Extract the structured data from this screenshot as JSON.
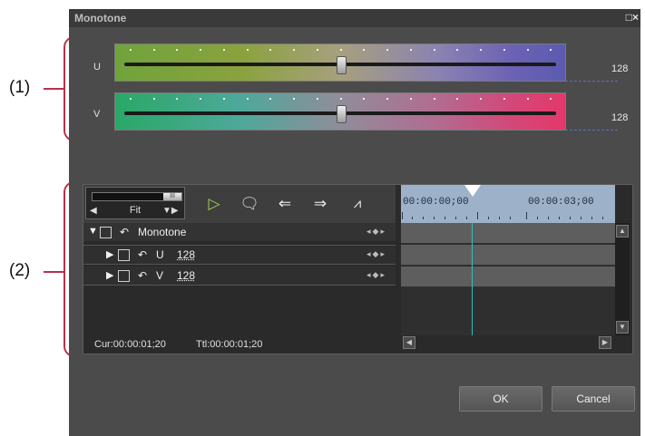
{
  "annotations": {
    "one": "(1)",
    "two": "(2)"
  },
  "dialog": {
    "title": "Monotone",
    "window_control": "□×"
  },
  "color_sliders": {
    "u": {
      "label": "U",
      "value": "128",
      "level": 0.5
    },
    "v": {
      "label": "V",
      "value": "128",
      "level": 0.5
    }
  },
  "keyframe_panel": {
    "zoom_label": "Fit",
    "zoom_handle": "III",
    "tracks": [
      {
        "label": "Monotone",
        "value": ""
      },
      {
        "label": "U",
        "value": "128"
      },
      {
        "label": "V",
        "value": "128"
      }
    ],
    "ruler": {
      "t1": "00:00:00;00",
      "t2": "00:00:03;00"
    },
    "status": {
      "cur": "Cur:00:00:01;20",
      "ttl": "Ttl:00:00:01;20"
    }
  },
  "buttons": {
    "ok": "OK",
    "cancel": "Cancel"
  },
  "colors": {
    "bracket": "#b8324b",
    "playhead": "#3bbcbc",
    "ruler": "#9db1c8"
  },
  "icons": [
    "play-icon",
    "add-keyframe-icon",
    "prev-keyframe-icon",
    "next-keyframe-icon",
    "graph-icon",
    "undo-icon",
    "expand-arrow-icon",
    "keyframe-nav-icon"
  ]
}
